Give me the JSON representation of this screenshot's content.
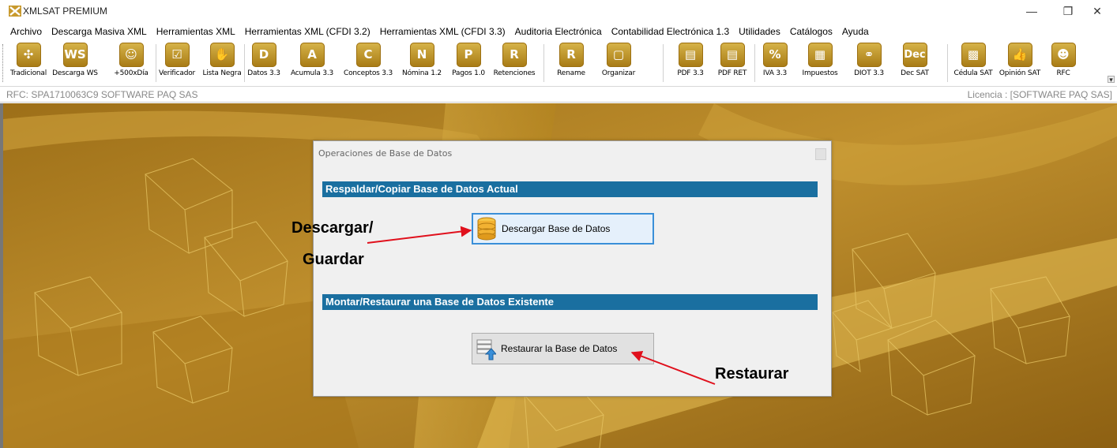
{
  "window": {
    "title": "XMLSAT PREMIUM"
  },
  "menu": [
    "Archivo",
    "Descarga Masiva XML",
    "Herramientas XML",
    "Herramientas XML (CFDI 3.2)",
    "Herramientas XML (CFDI 3.3)",
    "Auditoria Electrónica",
    "Contabilidad Electrónica 1.3",
    "Utilidades",
    "Catálogos",
    "Ayuda"
  ],
  "toolbar": [
    {
      "label": "Tradicional",
      "icon": "tradicional-icon",
      "glyph": "✣"
    },
    {
      "label": "Descarga WS",
      "icon": "ws-icon",
      "glyph": "WS"
    },
    {
      "label": "+500xDía",
      "icon": "plus500-icon",
      "glyph": "☺"
    },
    {
      "label": "Verificador",
      "icon": "checkbox-icon",
      "glyph": "☑"
    },
    {
      "label": "Lista Negra",
      "icon": "hand-icon",
      "glyph": "✋"
    },
    {
      "label": "Datos 3.3",
      "icon": "datos-icon",
      "glyph": "D"
    },
    {
      "label": "Acumula 3.3",
      "icon": "acumula-icon",
      "glyph": "A"
    },
    {
      "label": "Conceptos 3.3",
      "icon": "conceptos-icon",
      "glyph": "C"
    },
    {
      "label": "Nómina 1.2",
      "icon": "nomina-icon",
      "glyph": "N"
    },
    {
      "label": "Pagos 1.0",
      "icon": "pagos-icon",
      "glyph": "P"
    },
    {
      "label": "Retenciones",
      "icon": "retenciones-icon",
      "glyph": "R"
    },
    {
      "label": "Rename",
      "icon": "rename-icon",
      "glyph": "R"
    },
    {
      "label": "Organizar",
      "icon": "organizar-icon",
      "glyph": "▢"
    },
    {
      "label": "PDF 3.3",
      "icon": "pdf-icon",
      "glyph": "▤"
    },
    {
      "label": "PDF RET",
      "icon": "pdf-ret-icon",
      "glyph": "▤"
    },
    {
      "label": "IVA 3.3",
      "icon": "percent-icon",
      "glyph": "%"
    },
    {
      "label": "Impuestos",
      "icon": "calculator-icon",
      "glyph": "▦"
    },
    {
      "label": "DIOT 3.3",
      "icon": "handshake-icon",
      "glyph": "⚭"
    },
    {
      "label": "Dec SAT",
      "icon": "dec-icon",
      "glyph": "Dec"
    },
    {
      "label": "Cédula SAT",
      "icon": "qr-icon",
      "glyph": "▩"
    },
    {
      "label": "Opinión SAT",
      "icon": "thumbs-up-icon",
      "glyph": "👍"
    },
    {
      "label": "RFC",
      "icon": "person-icon",
      "glyph": "☻"
    }
  ],
  "infobar": {
    "rfc": "RFC: SPA1710063C9 SOFTWARE PAQ SAS",
    "license": "Licencia : [SOFTWARE PAQ SAS]"
  },
  "dialog": {
    "title": "Operaciones de Base de Datos",
    "section1": "Respaldar/Copiar Base de Datos Actual",
    "download_btn": "Descargar Base de Datos",
    "section2": "Montar/Restaurar una Base de Datos Existente",
    "restore_btn": "Restaurar la Base de Datos"
  },
  "annotations": {
    "download_line1": "Descargar/",
    "download_line2": "Guardar",
    "restore": "Restaurar"
  },
  "colors": {
    "accent": "#1a6fa0",
    "background": "#b17f1f",
    "arrow": "#e0101c"
  }
}
